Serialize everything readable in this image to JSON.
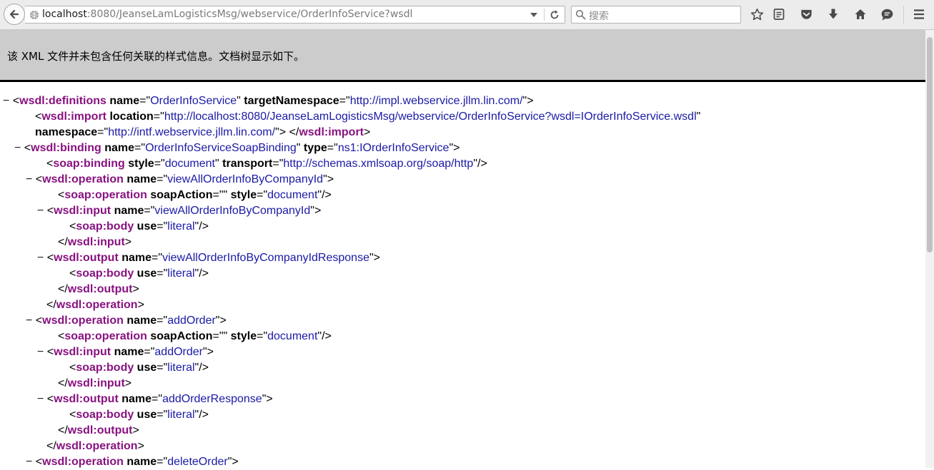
{
  "browser": {
    "url_host": "localhost",
    "url_rest": ":8080/JeanseLamLogisticsMsg/webservice/OrderInfoService?wsdl",
    "search_placeholder": "搜索"
  },
  "info_message": "该 XML 文件并未包含任何关联的样式信息。文档树显示如下。",
  "xml_lines": [
    {
      "indent": 0,
      "parts": [
        {
          "c": "tw",
          "t": "− "
        },
        {
          "c": "pn",
          "t": "<"
        },
        {
          "c": "tg",
          "t": "wsdl:definitions"
        },
        {
          "c": "an",
          "t": " name"
        },
        {
          "c": "pn",
          "t": "=\""
        },
        {
          "c": "av",
          "t": "OrderInfoService"
        },
        {
          "c": "pn",
          "t": "\""
        },
        {
          "c": "an",
          "t": " targetNamespace"
        },
        {
          "c": "pn",
          "t": "=\""
        },
        {
          "c": "av",
          "t": "http://impl.webservice.jllm.lin.com/"
        },
        {
          "c": "pn",
          "t": "\">"
        }
      ]
    },
    {
      "indent": 2,
      "parts": [
        {
          "c": "pn",
          "t": "<"
        },
        {
          "c": "tg",
          "t": "wsdl:import"
        },
        {
          "c": "an",
          "t": " location"
        },
        {
          "c": "pn",
          "t": "=\""
        },
        {
          "c": "av",
          "t": "http://localhost:8080/JeanseLamLogisticsMsg/webservice/OrderInfoService?wsdl=IOrderInfoService.wsdl"
        },
        {
          "c": "pn",
          "t": "\""
        }
      ]
    },
    {
      "indent": 2,
      "parts": [
        {
          "c": "an",
          "t": "namespace"
        },
        {
          "c": "pn",
          "t": "=\""
        },
        {
          "c": "av",
          "t": "http://intf.webservice.jllm.lin.com/"
        },
        {
          "c": "pn",
          "t": "\"> </"
        },
        {
          "c": "tg",
          "t": "wsdl:import"
        },
        {
          "c": "pn",
          "t": ">"
        }
      ]
    },
    {
      "indent": 1,
      "parts": [
        {
          "c": "tw",
          "t": "− "
        },
        {
          "c": "pn",
          "t": "<"
        },
        {
          "c": "tg",
          "t": "wsdl:binding"
        },
        {
          "c": "an",
          "t": " name"
        },
        {
          "c": "pn",
          "t": "=\""
        },
        {
          "c": "av",
          "t": "OrderInfoServiceSoapBinding"
        },
        {
          "c": "pn",
          "t": "\""
        },
        {
          "c": "an",
          "t": " type"
        },
        {
          "c": "pn",
          "t": "=\""
        },
        {
          "c": "av",
          "t": "ns1:IOrderInfoService"
        },
        {
          "c": "pn",
          "t": "\">"
        }
      ]
    },
    {
      "indent": 3,
      "parts": [
        {
          "c": "pn",
          "t": "<"
        },
        {
          "c": "tg",
          "t": "soap:binding"
        },
        {
          "c": "an",
          "t": " style"
        },
        {
          "c": "pn",
          "t": "=\""
        },
        {
          "c": "av",
          "t": "document"
        },
        {
          "c": "pn",
          "t": "\""
        },
        {
          "c": "an",
          "t": " transport"
        },
        {
          "c": "pn",
          "t": "=\""
        },
        {
          "c": "av",
          "t": "http://schemas.xmlsoap.org/soap/http"
        },
        {
          "c": "pn",
          "t": "\"/>"
        }
      ]
    },
    {
      "indent": 2,
      "parts": [
        {
          "c": "tw",
          "t": "− "
        },
        {
          "c": "pn",
          "t": "<"
        },
        {
          "c": "tg",
          "t": "wsdl:operation"
        },
        {
          "c": "an",
          "t": " name"
        },
        {
          "c": "pn",
          "t": "=\""
        },
        {
          "c": "av",
          "t": "viewAllOrderInfoByCompanyId"
        },
        {
          "c": "pn",
          "t": "\">"
        }
      ]
    },
    {
      "indent": 4,
      "parts": [
        {
          "c": "pn",
          "t": "<"
        },
        {
          "c": "tg",
          "t": "soap:operation"
        },
        {
          "c": "an",
          "t": " soapAction"
        },
        {
          "c": "pn",
          "t": "=\"\""
        },
        {
          "c": "an",
          "t": " style"
        },
        {
          "c": "pn",
          "t": "=\""
        },
        {
          "c": "av",
          "t": "document"
        },
        {
          "c": "pn",
          "t": "\"/>"
        }
      ]
    },
    {
      "indent": 3,
      "parts": [
        {
          "c": "tw",
          "t": "− "
        },
        {
          "c": "pn",
          "t": "<"
        },
        {
          "c": "tg",
          "t": "wsdl:input"
        },
        {
          "c": "an",
          "t": " name"
        },
        {
          "c": "pn",
          "t": "=\""
        },
        {
          "c": "av",
          "t": "viewAllOrderInfoByCompanyId"
        },
        {
          "c": "pn",
          "t": "\">"
        }
      ]
    },
    {
      "indent": 5,
      "parts": [
        {
          "c": "pn",
          "t": "<"
        },
        {
          "c": "tg",
          "t": "soap:body"
        },
        {
          "c": "an",
          "t": " use"
        },
        {
          "c": "pn",
          "t": "=\""
        },
        {
          "c": "av",
          "t": "literal"
        },
        {
          "c": "pn",
          "t": "\"/>"
        }
      ]
    },
    {
      "indent": 4,
      "parts": [
        {
          "c": "pn",
          "t": "</"
        },
        {
          "c": "tg",
          "t": "wsdl:input"
        },
        {
          "c": "pn",
          "t": ">"
        }
      ]
    },
    {
      "indent": 3,
      "parts": [
        {
          "c": "tw",
          "t": "− "
        },
        {
          "c": "pn",
          "t": "<"
        },
        {
          "c": "tg",
          "t": "wsdl:output"
        },
        {
          "c": "an",
          "t": " name"
        },
        {
          "c": "pn",
          "t": "=\""
        },
        {
          "c": "av",
          "t": "viewAllOrderInfoByCompanyIdResponse"
        },
        {
          "c": "pn",
          "t": "\">"
        }
      ]
    },
    {
      "indent": 5,
      "parts": [
        {
          "c": "pn",
          "t": "<"
        },
        {
          "c": "tg",
          "t": "soap:body"
        },
        {
          "c": "an",
          "t": " use"
        },
        {
          "c": "pn",
          "t": "=\""
        },
        {
          "c": "av",
          "t": "literal"
        },
        {
          "c": "pn",
          "t": "\"/>"
        }
      ]
    },
    {
      "indent": 4,
      "parts": [
        {
          "c": "pn",
          "t": "</"
        },
        {
          "c": "tg",
          "t": "wsdl:output"
        },
        {
          "c": "pn",
          "t": ">"
        }
      ]
    },
    {
      "indent": 3,
      "parts": [
        {
          "c": "pn",
          "t": "</"
        },
        {
          "c": "tg",
          "t": "wsdl:operation"
        },
        {
          "c": "pn",
          "t": ">"
        }
      ]
    },
    {
      "indent": 2,
      "parts": [
        {
          "c": "tw",
          "t": "− "
        },
        {
          "c": "pn",
          "t": "<"
        },
        {
          "c": "tg",
          "t": "wsdl:operation"
        },
        {
          "c": "an",
          "t": " name"
        },
        {
          "c": "pn",
          "t": "=\""
        },
        {
          "c": "av",
          "t": "addOrder"
        },
        {
          "c": "pn",
          "t": "\">"
        }
      ]
    },
    {
      "indent": 4,
      "parts": [
        {
          "c": "pn",
          "t": "<"
        },
        {
          "c": "tg",
          "t": "soap:operation"
        },
        {
          "c": "an",
          "t": " soapAction"
        },
        {
          "c": "pn",
          "t": "=\"\""
        },
        {
          "c": "an",
          "t": " style"
        },
        {
          "c": "pn",
          "t": "=\""
        },
        {
          "c": "av",
          "t": "document"
        },
        {
          "c": "pn",
          "t": "\"/>"
        }
      ]
    },
    {
      "indent": 3,
      "parts": [
        {
          "c": "tw",
          "t": "− "
        },
        {
          "c": "pn",
          "t": "<"
        },
        {
          "c": "tg",
          "t": "wsdl:input"
        },
        {
          "c": "an",
          "t": " name"
        },
        {
          "c": "pn",
          "t": "=\""
        },
        {
          "c": "av",
          "t": "addOrder"
        },
        {
          "c": "pn",
          "t": "\">"
        }
      ]
    },
    {
      "indent": 5,
      "parts": [
        {
          "c": "pn",
          "t": "<"
        },
        {
          "c": "tg",
          "t": "soap:body"
        },
        {
          "c": "an",
          "t": " use"
        },
        {
          "c": "pn",
          "t": "=\""
        },
        {
          "c": "av",
          "t": "literal"
        },
        {
          "c": "pn",
          "t": "\"/>"
        }
      ]
    },
    {
      "indent": 4,
      "parts": [
        {
          "c": "pn",
          "t": "</"
        },
        {
          "c": "tg",
          "t": "wsdl:input"
        },
        {
          "c": "pn",
          "t": ">"
        }
      ]
    },
    {
      "indent": 3,
      "parts": [
        {
          "c": "tw",
          "t": "− "
        },
        {
          "c": "pn",
          "t": "<"
        },
        {
          "c": "tg",
          "t": "wsdl:output"
        },
        {
          "c": "an",
          "t": " name"
        },
        {
          "c": "pn",
          "t": "=\""
        },
        {
          "c": "av",
          "t": "addOrderResponse"
        },
        {
          "c": "pn",
          "t": "\">"
        }
      ]
    },
    {
      "indent": 5,
      "parts": [
        {
          "c": "pn",
          "t": "<"
        },
        {
          "c": "tg",
          "t": "soap:body"
        },
        {
          "c": "an",
          "t": " use"
        },
        {
          "c": "pn",
          "t": "=\""
        },
        {
          "c": "av",
          "t": "literal"
        },
        {
          "c": "pn",
          "t": "\"/>"
        }
      ]
    },
    {
      "indent": 4,
      "parts": [
        {
          "c": "pn",
          "t": "</"
        },
        {
          "c": "tg",
          "t": "wsdl:output"
        },
        {
          "c": "pn",
          "t": ">"
        }
      ]
    },
    {
      "indent": 3,
      "parts": [
        {
          "c": "pn",
          "t": "</"
        },
        {
          "c": "tg",
          "t": "wsdl:operation"
        },
        {
          "c": "pn",
          "t": ">"
        }
      ]
    },
    {
      "indent": 2,
      "parts": [
        {
          "c": "tw",
          "t": "− "
        },
        {
          "c": "pn",
          "t": "<"
        },
        {
          "c": "tg",
          "t": "wsdl:operation"
        },
        {
          "c": "an",
          "t": " name"
        },
        {
          "c": "pn",
          "t": "=\""
        },
        {
          "c": "av",
          "t": "deleteOrder"
        },
        {
          "c": "pn",
          "t": "\">"
        }
      ]
    }
  ]
}
